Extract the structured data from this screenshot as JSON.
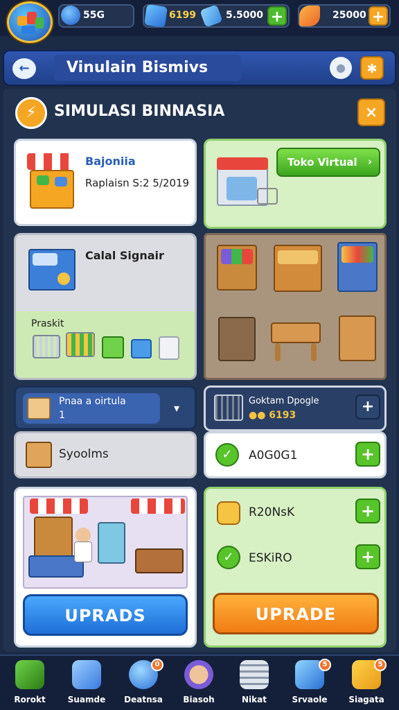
{
  "topbar": {
    "resource_1": "55G",
    "resource_2": "6199",
    "resource_3": "5.5000",
    "resource_4": "25000",
    "plus": "+"
  },
  "nav": {
    "back_icon": "←",
    "title": "Vinulain Bismivs",
    "location_icon": "●",
    "settings_icon": "✱"
  },
  "header": {
    "title": "SIMULASI BINNASIA",
    "close": "×"
  },
  "cards": {
    "stall": {
      "title": "Bajoniia",
      "subtitle": "Raplaisn S:2 5/2019"
    },
    "toko": {
      "button": "Toko Virtual",
      "arrow": "›"
    },
    "cashier": {
      "title": "Calal Signair",
      "section": "Praskit"
    },
    "produk": {
      "line1": "Pnaa a oirtula",
      "line2": "1",
      "pin": "▾"
    },
    "syoolms": {
      "label": "Syoolms"
    },
    "cart": {
      "title": "Goktam Dpogle",
      "value": "●● 6193"
    },
    "a0060": {
      "label": "A0G0G1"
    },
    "r20": {
      "label": "R20NsK"
    },
    "esk": {
      "label": "ESKiRO"
    }
  },
  "buttons": {
    "upgrade_left": "UPRADS",
    "upgrade_right": "UPRADE"
  },
  "tabs": [
    {
      "label": "Rorokt"
    },
    {
      "label": "Suamde"
    },
    {
      "label": "Deatnsa"
    },
    {
      "label": "Biasoh"
    },
    {
      "label": "Nikat"
    },
    {
      "label": "Srvaole"
    },
    {
      "label": "Siagata"
    }
  ],
  "tab_badges": [
    "0",
    "5",
    "5"
  ],
  "colors": {
    "accent_orange": "#f5a623",
    "accent_green": "#57c42a",
    "accent_blue": "#2f8fe6",
    "panel_dark": "#21334f"
  }
}
